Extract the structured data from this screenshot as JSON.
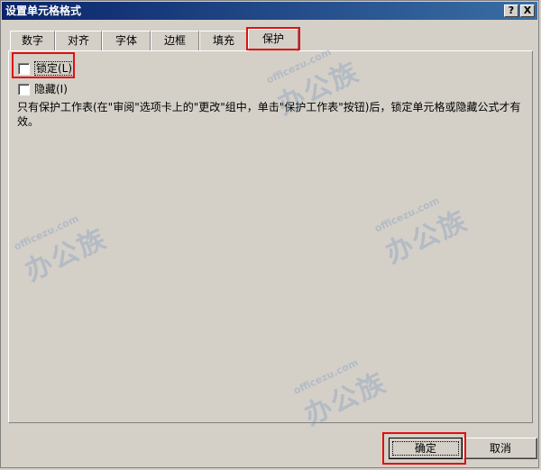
{
  "window": {
    "title": "设置单元格格式"
  },
  "titlebar_buttons": {
    "help": "?",
    "close": "X"
  },
  "tabs": [
    {
      "label": "数字"
    },
    {
      "label": "对齐"
    },
    {
      "label": "字体"
    },
    {
      "label": "边框"
    },
    {
      "label": "填充"
    },
    {
      "label": "保护"
    }
  ],
  "active_tab": "保护",
  "protection": {
    "locked_label": "锁定(L)",
    "locked_checked": false,
    "hidden_label": "隐藏(I)",
    "hidden_checked": false,
    "description": "只有保护工作表(在\"审阅\"选项卡上的\"更改\"组中，单击\"保护工作表\"按钮)后，锁定单元格或隐藏公式才有效。"
  },
  "buttons": {
    "ok": "确定",
    "cancel": "取消"
  },
  "watermark": {
    "site": "officezu.com",
    "brand": "办公族"
  },
  "colors": {
    "highlight": "#e01010",
    "titlebar": "#0a246a",
    "face": "#d4d0c8"
  }
}
